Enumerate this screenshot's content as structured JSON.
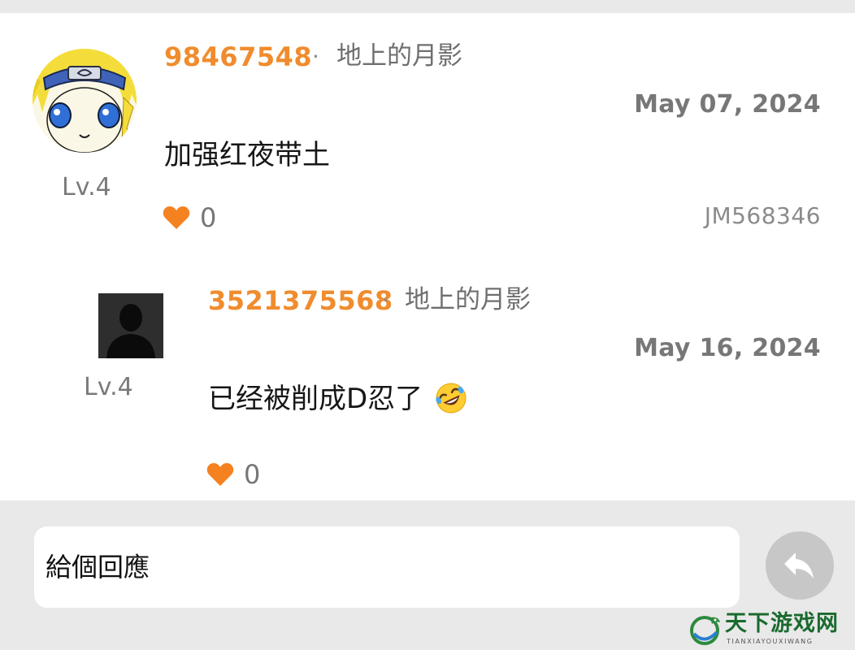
{
  "comments": [
    {
      "username": "98467548",
      "separator": "·",
      "topic": "地上的月影",
      "level": "Lv.4",
      "date": "May 07, 2024",
      "text": "加强红夜带土",
      "likes": "0",
      "uid": "JM568346",
      "avatar": "anime-character-avatar"
    },
    {
      "username": "3521375568",
      "separator": "·",
      "topic": "地上的月影",
      "level": "Lv.4",
      "date": "May 16, 2024",
      "text": "已经被削成D忍了",
      "emoji": "rolling-on-floor-laughing",
      "likes": "0",
      "avatar": "default-silhouette-avatar"
    }
  ],
  "reply_input": {
    "placeholder": "給個回應"
  },
  "send_button": {
    "icon": "reply-arrow-icon"
  },
  "watermark": {
    "title": "天下游戏网",
    "subtitle": "TIANXIAYOUXIWANG"
  },
  "colors": {
    "accent": "#f08c2d",
    "background": "#e9e9e9",
    "card": "#ffffff",
    "send_button": "#c7c7c7"
  }
}
